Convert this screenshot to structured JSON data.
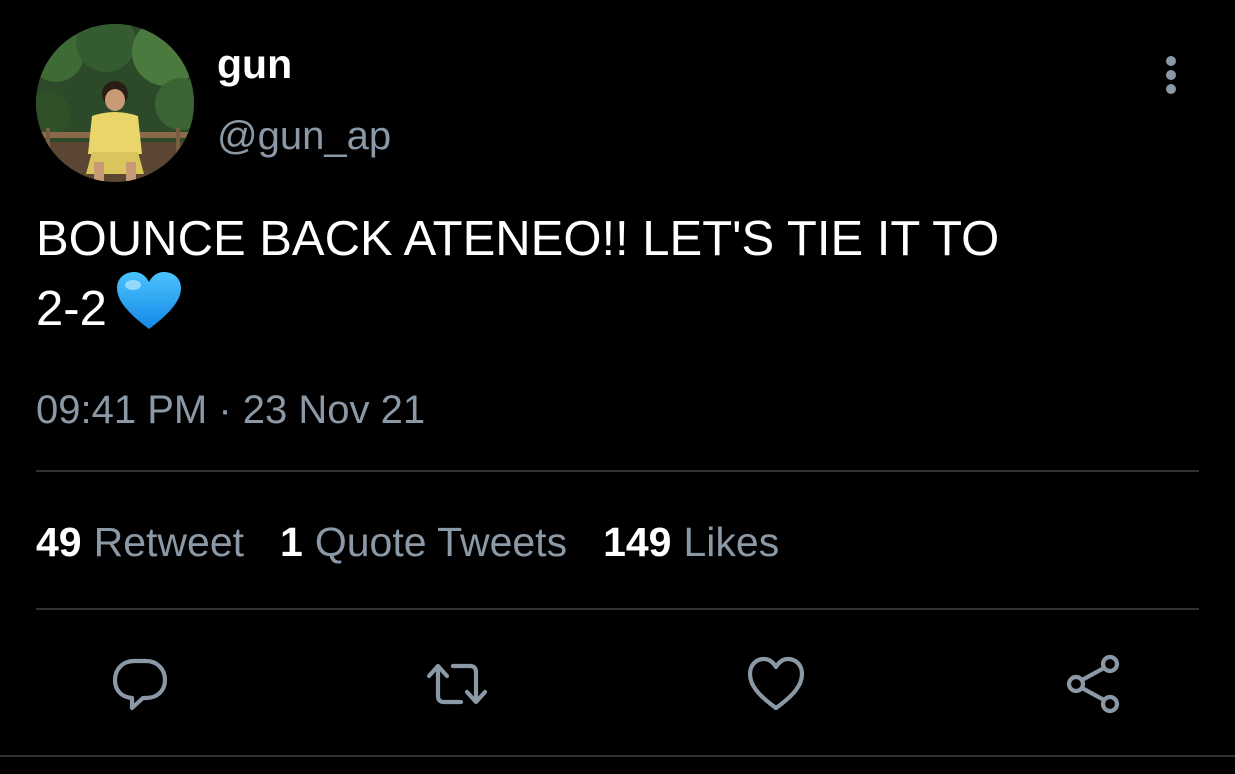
{
  "user": {
    "display_name": "gun",
    "handle": "@gun_ap",
    "avatar_icon": "profile-photo"
  },
  "more_icon": "more-vertical-icon",
  "tweet": {
    "text_line1": "BOUNCE BACK ATENEO!! LET'S TIE IT TO",
    "text_line2": "2-2",
    "emoji": "blue-heart-emoji",
    "timestamp": "09:41 PM · 23 Nov 21"
  },
  "stats": {
    "retweets": {
      "count": "49",
      "label": "Retweet"
    },
    "quotes": {
      "count": "1",
      "label": "Quote Tweets"
    },
    "likes": {
      "count": "149",
      "label": "Likes"
    }
  },
  "actions": [
    "reply-icon",
    "retweet-icon",
    "like-icon",
    "share-icon"
  ],
  "colors": {
    "background": "#000000",
    "primary_text": "#ffffff",
    "secondary_text": "#8b98a5",
    "divider": "#2f3336",
    "heart": "#1da1f2"
  }
}
